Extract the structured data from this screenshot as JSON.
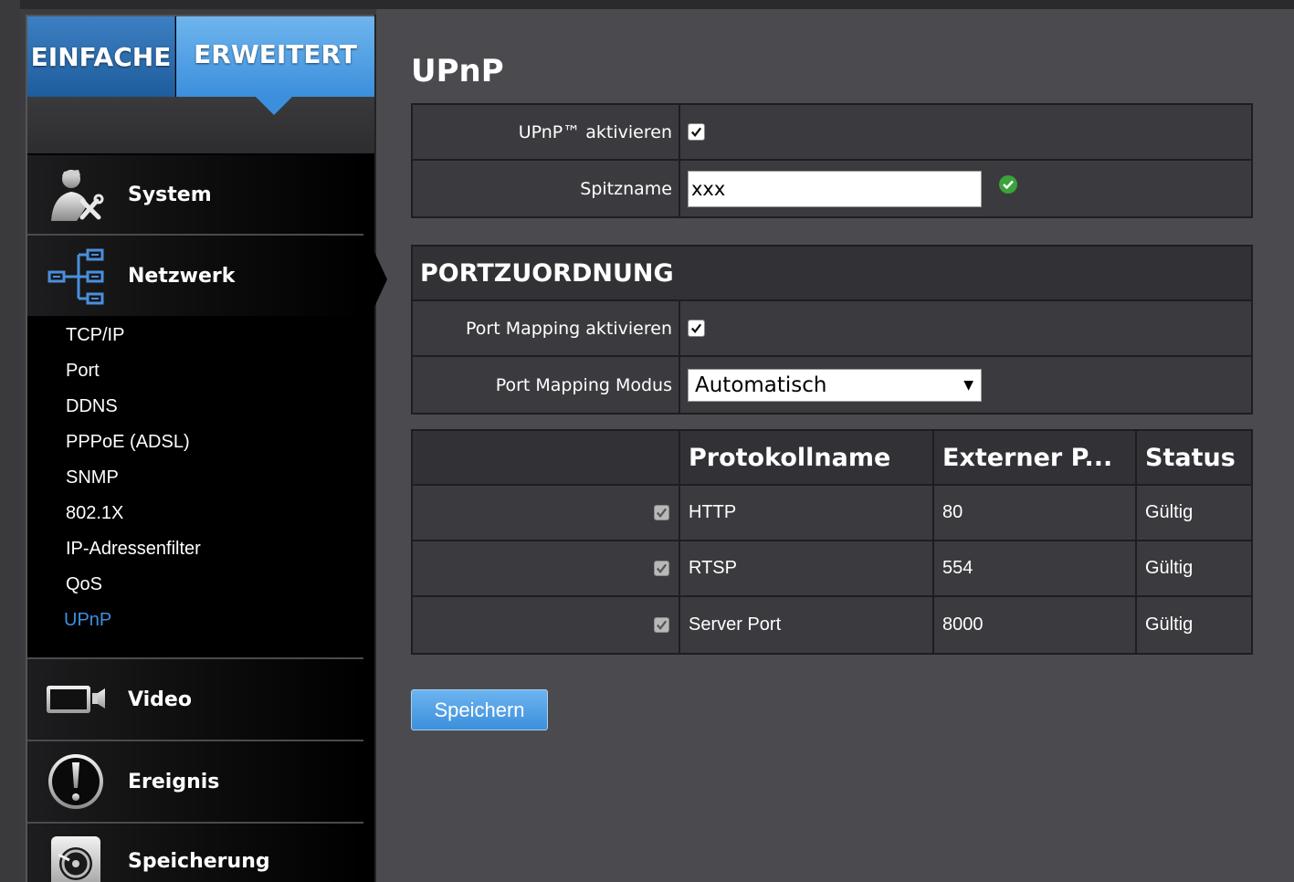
{
  "mode_tabs": {
    "basic": "EINFACHE",
    "advanced": "ERWEITERT"
  },
  "sidebar": {
    "sections": [
      {
        "label": "System"
      },
      {
        "label": "Netzwerk"
      },
      {
        "label": "Video"
      },
      {
        "label": "Ereignis"
      },
      {
        "label": "Speicherung"
      }
    ],
    "network_items": [
      "TCP/IP",
      "Port",
      "DDNS",
      "PPPoE (ADSL)",
      "SNMP",
      "802.1X",
      "IP-Adressenfilter",
      "QoS",
      "UPnP"
    ],
    "active_item": "UPnP"
  },
  "page": {
    "title": "UPnP",
    "upnp_enable_label": "UPnP™ aktivieren",
    "upnp_enabled": true,
    "nickname_label": "Spitzname",
    "nickname_value": "xxx",
    "port_section_title": "PORTZUORDNUNG",
    "port_mapping_enable_label": "Port Mapping aktivieren",
    "port_mapping_enabled": true,
    "port_mapping_mode_label": "Port Mapping Modus",
    "port_mapping_mode_value": "Automatisch",
    "save_label": "Speichern"
  },
  "port_table": {
    "headers": {
      "protocol": "Protokollname",
      "external": "Externer P...",
      "status": "Status"
    },
    "rows": [
      {
        "protocol": "HTTP",
        "external": "80",
        "status": "Gültig",
        "checked": true
      },
      {
        "protocol": "RTSP",
        "external": "554",
        "status": "Gültig",
        "checked": true
      },
      {
        "protocol": "Server Port",
        "external": "8000",
        "status": "Gültig",
        "checked": true
      }
    ]
  },
  "colors": {
    "accent": "#3d8fe0",
    "tab_basic": "#2a6fb2",
    "tab_advanced": "#4f9fe4",
    "ok_green": "#3aa33a"
  },
  "icons": {
    "system": "admin-tools-icon",
    "network": "network-tree-icon",
    "video": "camera-icon",
    "event": "alert-icon",
    "storage": "disk-icon",
    "nickname_ok": "check-circle-icon"
  }
}
